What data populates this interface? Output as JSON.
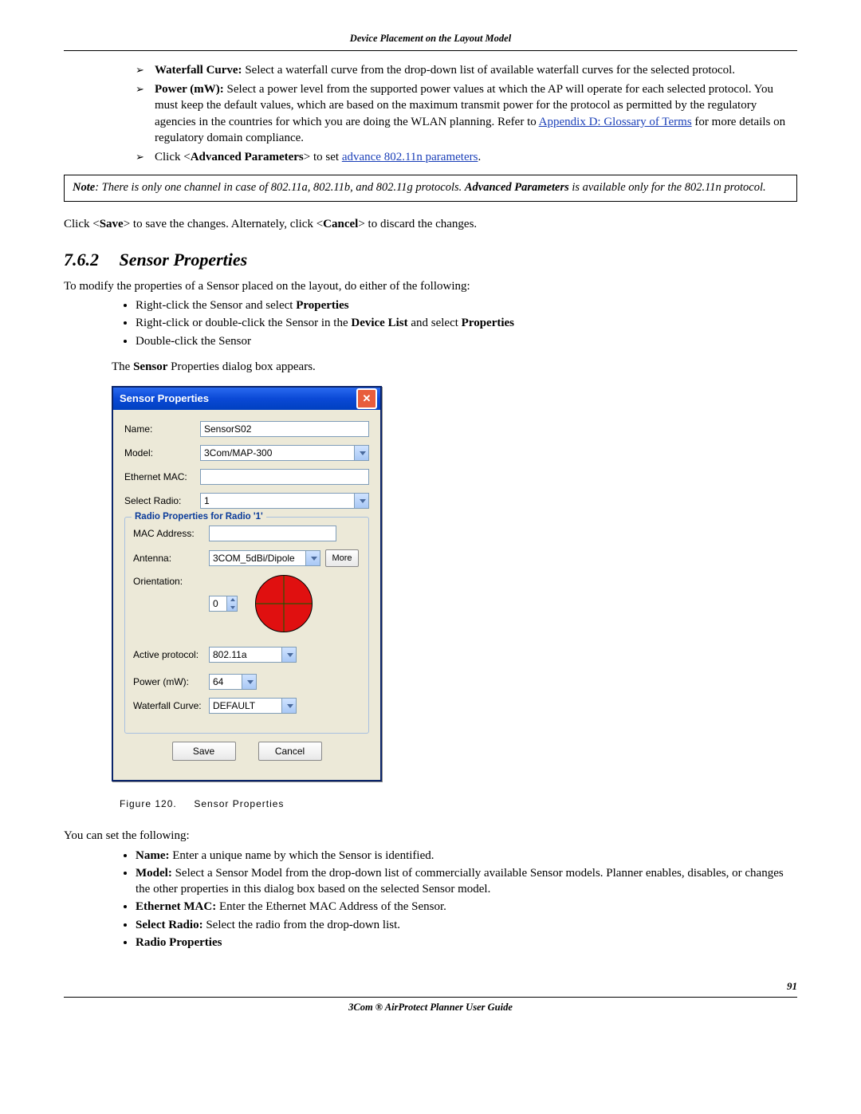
{
  "header": {
    "running": "Device Placement on the Layout Model"
  },
  "top_list": {
    "waterfall": {
      "label": "Waterfall Curve:",
      "text": "Select a waterfall curve from the drop-down list of available waterfall curves for the selected protocol."
    },
    "power": {
      "label": "Power (mW):",
      "text": "Select a power level from the supported power values at which the AP will operate for each selected protocol. You must keep the default values, which are based on the maximum transmit power for the protocol as permitted by the regulatory agencies in the countries for which you are doing the WLAN planning. Refer to ",
      "link": "Appendix D: Glossary of Terms",
      "tail": " for more details on regulatory domain compliance."
    },
    "advanced": {
      "pre": "Click <",
      "bold": "Advanced Parameters",
      "mid": "> to set ",
      "link": "advance 802.11n parameters",
      "post": "."
    }
  },
  "note": {
    "prefix": "Note",
    "body": ": There is only one channel in case of 802.11a, 802.11b, and 802.11g protocols. ",
    "bold": "Advanced Parameters",
    "tail": " is available only for the 802.11n protocol."
  },
  "save_line": {
    "a": "Click <",
    "b": "Save",
    "c": "> to save the changes. Alternately, click <",
    "d": "Cancel",
    "e": "> to discard the changes."
  },
  "section": {
    "num": "7.6.2",
    "title": "Sensor Properties"
  },
  "intro": "To modify the properties of a Sensor placed on the layout, do either of the following:",
  "steps": {
    "s1a": "Right-click the Sensor and select ",
    "s1b": "Properties",
    "s2a": "Right-click or double-click the Sensor in the ",
    "s2b": "Device List",
    "s2c": " and select ",
    "s2d": "Properties",
    "s3": "Double-click the Sensor"
  },
  "appears": {
    "a": "The ",
    "b": "Sensor",
    "c": " Properties dialog box appears."
  },
  "dialog": {
    "title": "Sensor Properties",
    "labels": {
      "name": "Name:",
      "model": "Model:",
      "emac": "Ethernet MAC:",
      "radio": "Select Radio:",
      "legend": "Radio Properties for Radio '1'",
      "mac": "MAC Address:",
      "antenna": "Antenna:",
      "orientation": "Orientation:",
      "active": "Active protocol:",
      "power": "Power (mW):",
      "waterfall": "Waterfall Curve:"
    },
    "values": {
      "name": "SensorS02",
      "model": "3Com/MAP-300",
      "emac": "",
      "radio": "1",
      "mac": "",
      "antenna": "3COM_5dBi/Dipole",
      "orientation": "0",
      "active": "802.11a",
      "power": "64",
      "waterfall": "DEFAULT"
    },
    "buttons": {
      "more": "More",
      "save": "Save",
      "cancel": "Cancel"
    }
  },
  "figure": {
    "num": "Figure 120.",
    "title": "Sensor Properties"
  },
  "after": "You can set the following:",
  "props": {
    "name": {
      "label": "Name:",
      "text": "Enter a unique name by which the Sensor is identified."
    },
    "model": {
      "label": "Model:",
      "text": "Select a Sensor Model from the drop-down list of commercially available Sensor models. Planner enables, disables, or changes the other properties in this dialog box based on the selected Sensor model."
    },
    "emac": {
      "label": "Ethernet MAC:",
      "text": "Enter the Ethernet MAC Address of the Sensor."
    },
    "radio": {
      "label": "Select Radio:",
      "text": "Select the radio from the drop-down list."
    },
    "rp": {
      "label": "Radio Properties"
    }
  },
  "page_number": "91",
  "footer": "3Com ® AirProtect Planner User Guide"
}
